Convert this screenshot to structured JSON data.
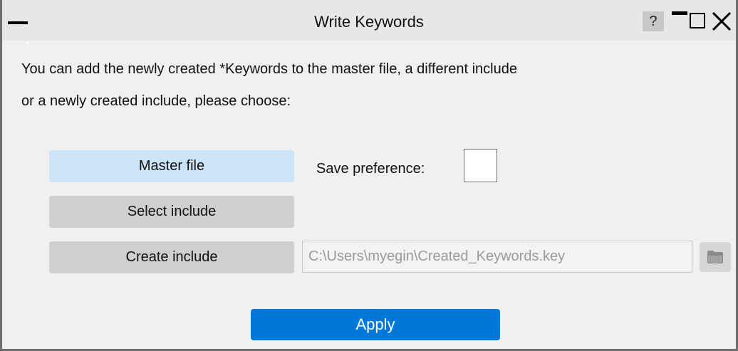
{
  "window": {
    "title": "Write Keywords",
    "help_label": "?"
  },
  "message": {
    "line1": "You can add the newly created *Keywords to the master file, a different include",
    "line2": "or a newly created include, please choose:"
  },
  "options": {
    "master_label": "Master file",
    "select_label": "Select include",
    "create_label": "Create include"
  },
  "preference": {
    "label": "Save preference:",
    "checked": false
  },
  "include_path": {
    "value": "C:\\Users\\myegin\\Created_Keywords.key"
  },
  "apply_label": "Apply",
  "icons": {
    "menu": "menu-bar-icon",
    "minimize": "minimize-icon",
    "maximize": "maximize-icon",
    "close": "close-icon",
    "browse": "folder-icon"
  },
  "colors": {
    "accent": "#0078d7",
    "selected_option": "#cce4f7",
    "option": "#cfcfcf"
  }
}
